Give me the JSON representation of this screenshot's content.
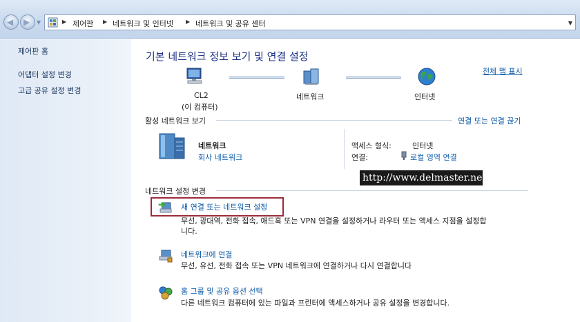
{
  "addressbar": {
    "breadcrumbs": [
      "제어판",
      "네트워크 및 인터넷",
      "네트워크 및 공유 센터"
    ]
  },
  "sidebar": {
    "home": "제어판 홈",
    "items": [
      {
        "label": "어댑터 설정 변경"
      },
      {
        "label": "고급 공유 설정 변경"
      }
    ]
  },
  "main": {
    "title": "기본 네트워크 정보 보기 및 연결 설정",
    "full_map_link": "전체 맵 표시",
    "map": {
      "computer_name": "CL2",
      "computer_sub": "(이 컴퓨터)",
      "network": "네트워크",
      "internet": "인터넷"
    },
    "active": {
      "heading": "활성 네트워크 보기",
      "connect_link": "연결 또는 연결 끊기",
      "network_name": "네트워크",
      "network_type": "회사 네트워크",
      "access_label": "액세스 형식:",
      "access_value": "인터넷",
      "connection_label": "연결:",
      "connection_value": "로컬 영역 연결"
    },
    "settings": {
      "heading": "네트워크 설정 변경",
      "tasks": [
        {
          "title": "새 연결 또는 네트워크 설정",
          "desc": [
            "무선, 광대역, 전화 접속, 애드혹 또는 VPN 연결을 설정하거나 라우터 또는 액세스 지점을 설정합",
            "니다."
          ]
        },
        {
          "title": "네트워크에 연결",
          "desc": [
            "무선, 유선, 전화 접속 또는 VPN 네트워크에 연결하거나 다시 연결합니다"
          ]
        },
        {
          "title": "홈 그룹 및 공유 옵션 선택",
          "desc": [
            "다른 네트워크 컴퓨터에 있는 파일과 프린터에 액세스하거나 공유 설정을 변경합니다."
          ]
        }
      ]
    },
    "watermark": "http://www.delmaster.net"
  },
  "colors": {
    "title": "#1e3287",
    "link": "#0b5aa8",
    "highlight_border": "#9b2b3a"
  }
}
